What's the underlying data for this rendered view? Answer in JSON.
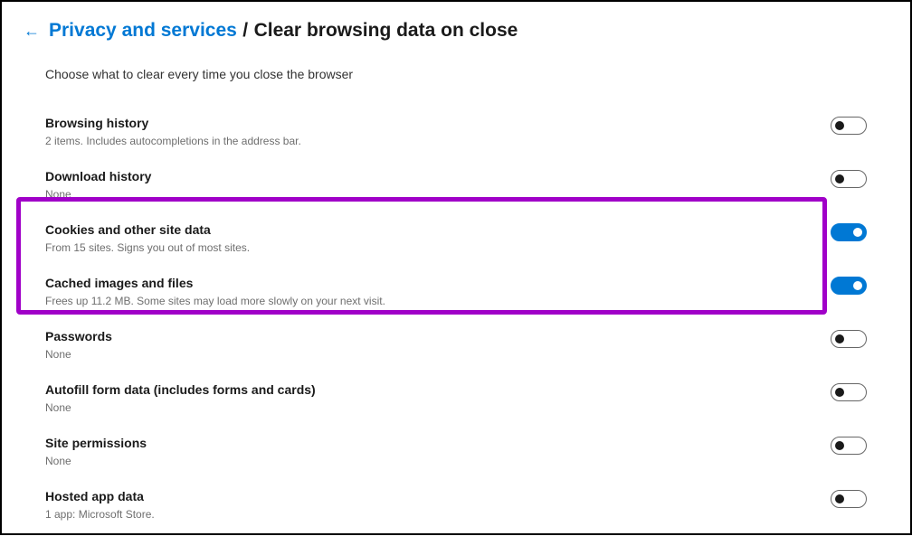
{
  "header": {
    "breadcrumb_link": "Privacy and services",
    "breadcrumb_sep": "/",
    "page_title": "Clear browsing data on close"
  },
  "subtitle": "Choose what to clear every time you close the browser",
  "items": [
    {
      "title": "Browsing history",
      "desc": "2 items. Includes autocompletions in the address bar.",
      "on": false
    },
    {
      "title": "Download history",
      "desc": "None",
      "on": false
    },
    {
      "title": "Cookies and other site data",
      "desc": "From 15 sites. Signs you out of most sites.",
      "on": true
    },
    {
      "title": "Cached images and files",
      "desc": "Frees up 11.2 MB. Some sites may load more slowly on your next visit.",
      "on": true
    },
    {
      "title": "Passwords",
      "desc": "None",
      "on": false
    },
    {
      "title": "Autofill form data (includes forms and cards)",
      "desc": "None",
      "on": false
    },
    {
      "title": "Site permissions",
      "desc": "None",
      "on": false
    },
    {
      "title": "Hosted app data",
      "desc": "1 app: Microsoft Store.",
      "on": false
    }
  ]
}
